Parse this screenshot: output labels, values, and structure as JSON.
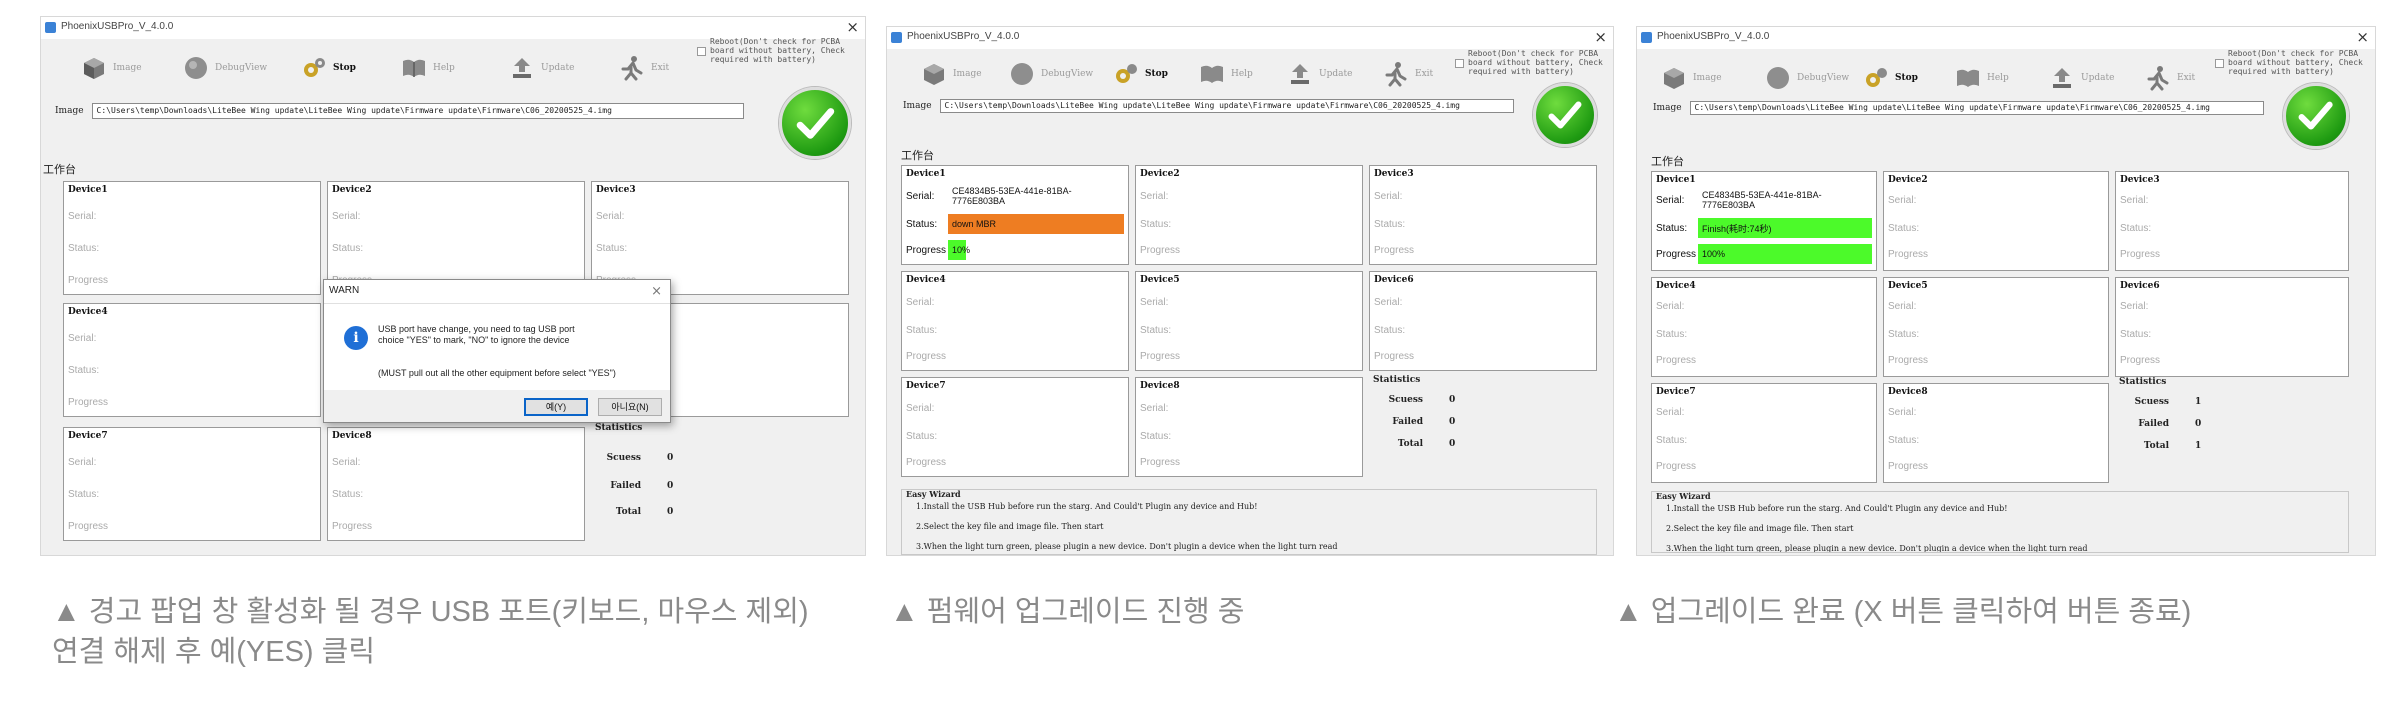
{
  "app": {
    "title": "PhoenixUSBPro_V_4.0.0",
    "close_glyph": "×"
  },
  "toolbar": [
    {
      "label": "Image",
      "icon": "cube-icon"
    },
    {
      "label": "DebugView",
      "icon": "circle-icon"
    },
    {
      "label": "Stop",
      "icon": "gears-icon"
    },
    {
      "label": "Help",
      "icon": "book-icon"
    },
    {
      "label": "Update",
      "icon": "upload-icon"
    },
    {
      "label": "Exit",
      "icon": "runner-icon"
    }
  ],
  "reboot_text": "Reboot(Don't check for PCBA board without battery, Check required with battery)",
  "image_label": "Image",
  "image_path": "C:\\Users\\temp\\Downloads\\LiteBee Wing update\\LiteBee Wing update\\Firmware update\\Firmware\\C06_20200525_4.img",
  "worktable_label": "工作台",
  "row_labels": {
    "serial": "Serial:",
    "status": "Status:",
    "progress": "Progress"
  },
  "devices": [
    "Device1",
    "Device2",
    "Device3",
    "Device4",
    "Device5",
    "Device6",
    "Device7",
    "Device8"
  ],
  "stats_labels": {
    "heading": "Statistics",
    "success": "Scuess",
    "failed": "Failed",
    "total": "Total"
  },
  "wizard": {
    "title": "Easy Wizard",
    "lines": [
      "1.Install the USB Hub before run the starg. And Could't Plugin any device and Hub!",
      "2.Select the key file and image file. Then start",
      "3.When the light turn green, please plugin a new device. Don't plugin a device when the light turn read"
    ]
  },
  "screens": [
    {
      "stats": {
        "success": "0",
        "failed": "0",
        "total": "0"
      },
      "device1": null,
      "dialog": {
        "title": "WARN",
        "line1": "USB port have change, you need to tag USB port",
        "line2": "choice \"YES\" to mark, \"NO\" to ignore the device",
        "line3": "(MUST pull out all the other equipment before  select \"YES\")",
        "yes": "예(Y)",
        "no": "아니요(N)"
      }
    },
    {
      "stats": {
        "success": "0",
        "failed": "0",
        "total": "0"
      },
      "device1": {
        "serial": "CE4834B5-53EA-441e-81BA-7776E803BA",
        "status": "down MBR",
        "progress_text": "10%",
        "progress": 0.1,
        "status_color": "#ee7d22"
      }
    },
    {
      "stats": {
        "success": "1",
        "failed": "0",
        "total": "1"
      },
      "device1": {
        "serial": "CE4834B5-53EA-441e-81BA-7776E803BA",
        "status": "Finish(耗时:74秒)",
        "progress_text": "100%",
        "progress": 1.0,
        "status_color": "#4cfa2a"
      }
    }
  ],
  "captions": [
    {
      "line1": "▲ 경고 팝업 창 활성화 될 경우 USB 포트(키보드, 마우스 제외)",
      "line2": "연결 해제 후 예(YES) 클릭"
    },
    {
      "line1": "▲  펌웨어 업그레이드 진행 중"
    },
    {
      "line1": "▲  업그레이드 완료 (X 버튼 클릭하여 버튼 종료)"
    }
  ],
  "colors": {
    "ok_green": "#1f9b12",
    "progress_green": "#4cfa2a",
    "status_orange": "#ee7d22",
    "info_blue": "#1f6fd6"
  }
}
